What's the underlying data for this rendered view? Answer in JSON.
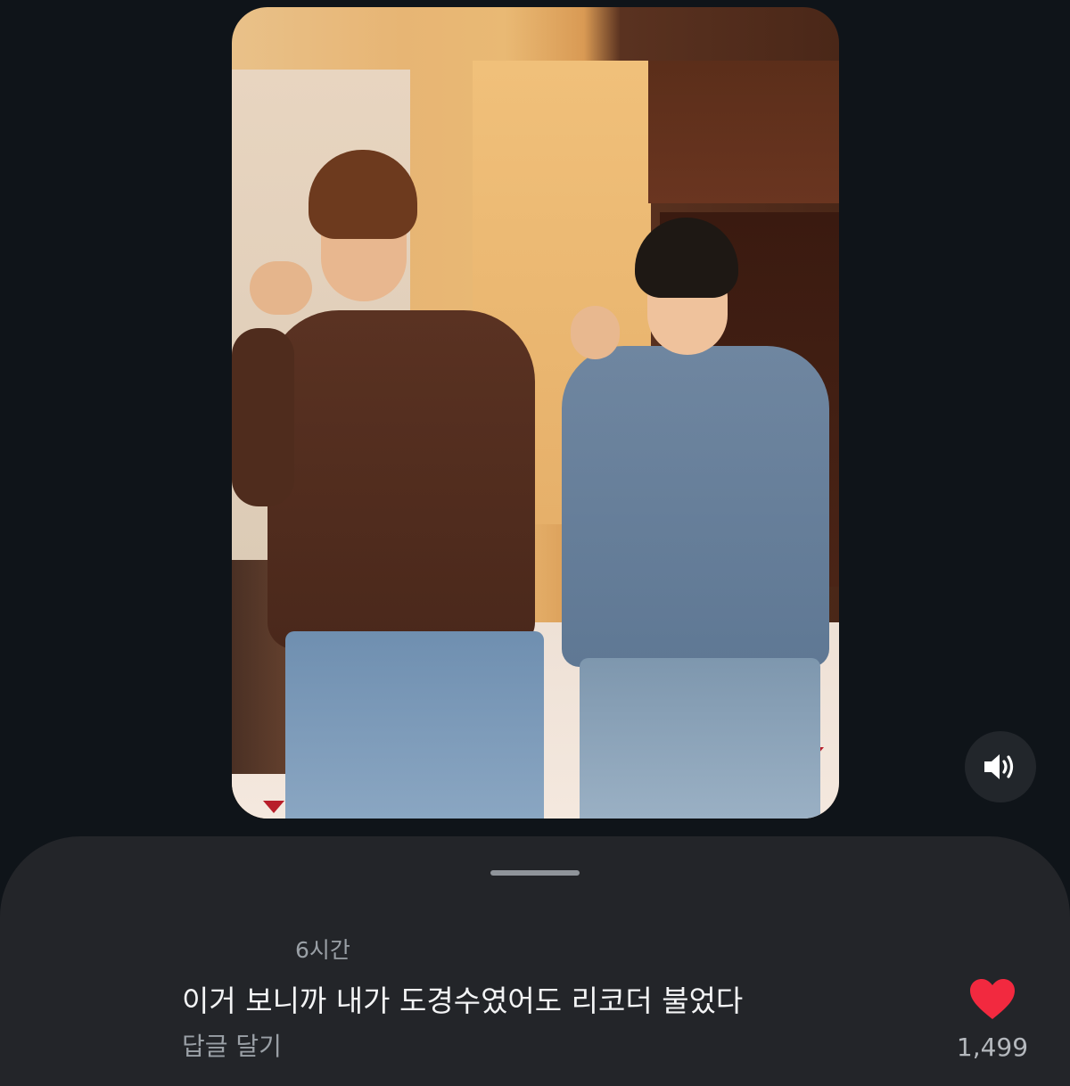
{
  "video": {
    "description_icon": "video-frame"
  },
  "controls": {
    "sound_icon": "speaker-volume-icon"
  },
  "comment": {
    "time": "6시간",
    "text": "이거 보니까 내가 도경수였어도 리코더 불었다",
    "reply_label": "답글 달기",
    "like_count": "1,499",
    "like_icon": "heart-icon",
    "like_color": "#f2293f"
  },
  "colors": {
    "background": "#0f1419",
    "sheet": "#232529",
    "muted_text": "#9aa0a6"
  }
}
